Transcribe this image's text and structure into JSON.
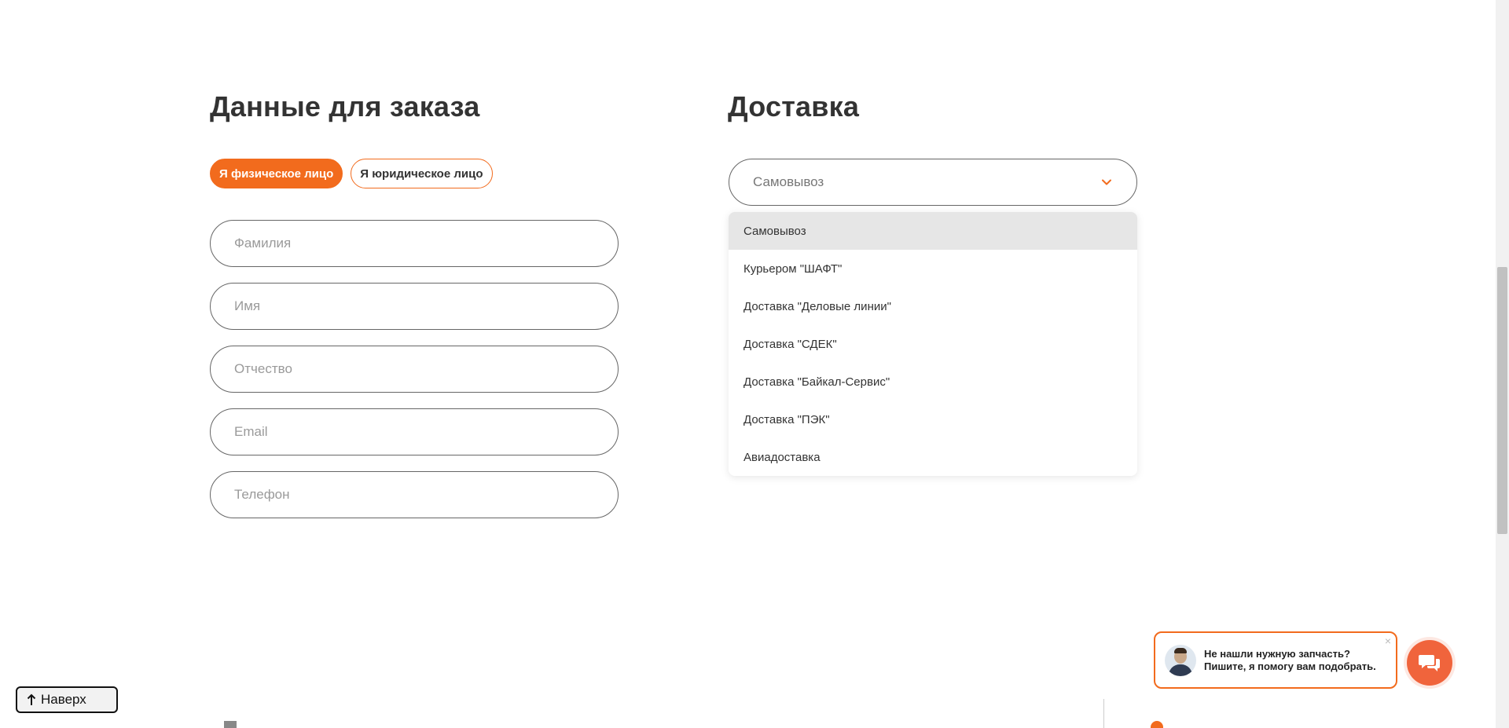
{
  "order": {
    "title": "Данные для заказа",
    "person_types": [
      "Я физическое лицо",
      "Я юридическое лицо"
    ],
    "fields": [
      {
        "placeholder": "Фамилия",
        "value": ""
      },
      {
        "placeholder": "Имя",
        "value": ""
      },
      {
        "placeholder": "Отчество",
        "value": ""
      },
      {
        "placeholder": "Email",
        "value": ""
      },
      {
        "placeholder": "Телефон",
        "value": ""
      }
    ]
  },
  "delivery": {
    "title": "Доставка",
    "selected": "Самовывоз",
    "options": [
      "Самовывоз",
      "Курьером \"ШАФТ\"",
      "Доставка \"Деловые линии\"",
      "Доставка \"СДЕК\"",
      "Доставка \"Байкал-Сервис\"",
      "Доставка \"ПЭК\"",
      "Авиадоставка"
    ]
  },
  "back_to_top": {
    "label": "Наверх",
    "icon": "arrow-up-icon"
  },
  "chat": {
    "message": "Не нашли нужную запчасть? Пишите, я помогу вам подобрать.",
    "close": "×",
    "icon": "chat-bubbles-icon"
  },
  "colors": {
    "accent": "#f26b1d",
    "chat_button": "#f0643c"
  }
}
